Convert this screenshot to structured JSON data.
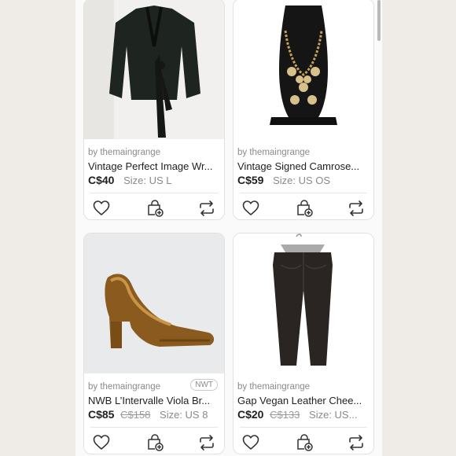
{
  "listings": [
    {
      "seller": "by themaingrange",
      "title": "Vintage Perfect Image Wr...",
      "price": "C$40",
      "original_price": "",
      "size": "Size: US L",
      "badge": ""
    },
    {
      "seller": "by themaingrange",
      "title": "Vintage Signed Camrose...",
      "price": "C$59",
      "original_price": "",
      "size": "Size: US OS",
      "badge": ""
    },
    {
      "seller": "by themaingrange",
      "title": "NWB L’Intervalle Viola Br...",
      "price": "C$85",
      "original_price": "C$158",
      "size": "Size: US 8",
      "badge": "NWT"
    },
    {
      "seller": "by themaingrange",
      "title": "Gap Vegan Leather Chee...",
      "price": "C$20",
      "original_price": "C$133",
      "size": "Size: US...",
      "badge": ""
    }
  ],
  "icons": {
    "like": "heart-icon",
    "bundle": "bundle-bag-icon",
    "share": "share-icon"
  },
  "colors": {
    "background": "#efebe6",
    "card": "#ffffff",
    "text": "#1f1f1f",
    "muted": "#8a8a8a"
  }
}
